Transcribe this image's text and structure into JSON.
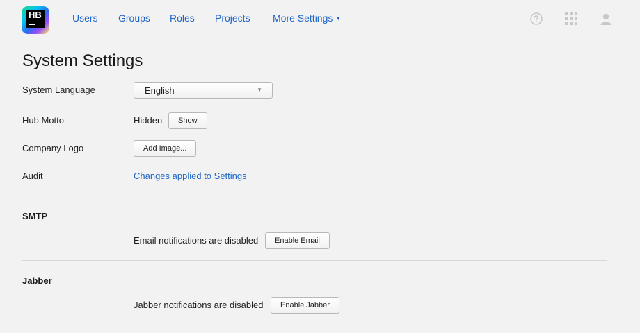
{
  "logo": {
    "text": "HB"
  },
  "nav": {
    "users": "Users",
    "groups": "Groups",
    "roles": "Roles",
    "projects": "Projects",
    "more_settings": "More Settings"
  },
  "header_icons": [
    "help-icon",
    "apps-grid-icon",
    "user-avatar-icon"
  ],
  "page": {
    "title": "System Settings"
  },
  "settings": {
    "language": {
      "label": "System Language",
      "value": "English"
    },
    "motto": {
      "label": "Hub Motto",
      "status": "Hidden",
      "button": "Show"
    },
    "logo": {
      "label": "Company Logo",
      "button": "Add Image..."
    },
    "audit": {
      "label": "Audit",
      "link": "Changes applied to Settings"
    }
  },
  "smtp": {
    "title": "SMTP",
    "status": "Email notifications are disabled",
    "button": "Enable Email"
  },
  "jabber": {
    "title": "Jabber",
    "status": "Jabber notifications are disabled",
    "button": "Enable Jabber"
  },
  "colors": {
    "link": "#1f66c7",
    "background": "#f2f2f2",
    "icon": "#c8c8c8"
  }
}
